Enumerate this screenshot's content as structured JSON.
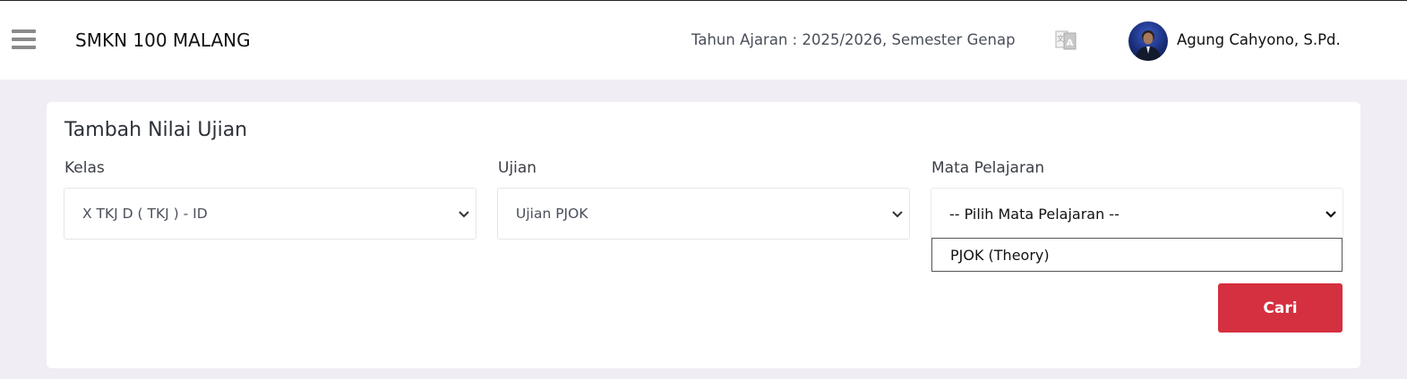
{
  "header": {
    "menu_icon": "hamburger-menu-icon",
    "school_name": "SMKN 100 MALANG",
    "academic_year": "Tahun Ajaran : 2025/2026, Semester Genap",
    "translate_icon": "translate-icon",
    "user_name": "Agung Cahyono, S.Pd."
  },
  "form": {
    "title": "Tambah Nilai Ujian",
    "kelas": {
      "label": "Kelas",
      "selected": "X TKJ D ( TKJ ) - ID"
    },
    "ujian": {
      "label": "Ujian",
      "selected": "Ujian PJOK"
    },
    "mapel": {
      "label": "Mata Pelajaran",
      "selected": "-- Pilih Mata Pelajaran --",
      "options": [
        "PJOK (Theory)"
      ]
    },
    "submit_label": "Cari"
  },
  "colors": {
    "background": "#f1edf4",
    "accent": "#d4303f"
  }
}
